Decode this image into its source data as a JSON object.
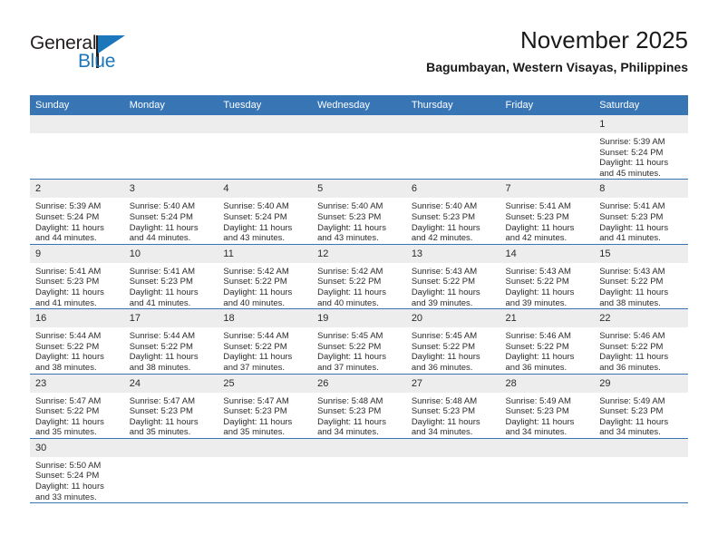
{
  "brand": {
    "name_part1": "General",
    "name_part2": "Blue",
    "accent_color": "#1b76bc"
  },
  "header": {
    "month_title": "November 2025",
    "location": "Bagumbayan, Western Visayas, Philippines"
  },
  "calendar": {
    "header_color": "#3775b5",
    "daynum_bg": "#ededed",
    "weekday_headers": [
      "Sunday",
      "Monday",
      "Tuesday",
      "Wednesday",
      "Thursday",
      "Friday",
      "Saturday"
    ],
    "weeks": [
      [
        {
          "blank": true,
          "day": "",
          "l1": "",
          "l2": "",
          "l3": "",
          "l4": ""
        },
        {
          "blank": true,
          "day": "",
          "l1": "",
          "l2": "",
          "l3": "",
          "l4": ""
        },
        {
          "blank": true,
          "day": "",
          "l1": "",
          "l2": "",
          "l3": "",
          "l4": ""
        },
        {
          "blank": true,
          "day": "",
          "l1": "",
          "l2": "",
          "l3": "",
          "l4": ""
        },
        {
          "blank": true,
          "day": "",
          "l1": "",
          "l2": "",
          "l3": "",
          "l4": ""
        },
        {
          "blank": true,
          "day": "",
          "l1": "",
          "l2": "",
          "l3": "",
          "l4": ""
        },
        {
          "blank": false,
          "day": "1",
          "l1": "Sunrise: 5:39 AM",
          "l2": "Sunset: 5:24 PM",
          "l3": "Daylight: 11 hours",
          "l4": "and 45 minutes."
        }
      ],
      [
        {
          "blank": false,
          "day": "2",
          "l1": "Sunrise: 5:39 AM",
          "l2": "Sunset: 5:24 PM",
          "l3": "Daylight: 11 hours",
          "l4": "and 44 minutes."
        },
        {
          "blank": false,
          "day": "3",
          "l1": "Sunrise: 5:40 AM",
          "l2": "Sunset: 5:24 PM",
          "l3": "Daylight: 11 hours",
          "l4": "and 44 minutes."
        },
        {
          "blank": false,
          "day": "4",
          "l1": "Sunrise: 5:40 AM",
          "l2": "Sunset: 5:24 PM",
          "l3": "Daylight: 11 hours",
          "l4": "and 43 minutes."
        },
        {
          "blank": false,
          "day": "5",
          "l1": "Sunrise: 5:40 AM",
          "l2": "Sunset: 5:23 PM",
          "l3": "Daylight: 11 hours",
          "l4": "and 43 minutes."
        },
        {
          "blank": false,
          "day": "6",
          "l1": "Sunrise: 5:40 AM",
          "l2": "Sunset: 5:23 PM",
          "l3": "Daylight: 11 hours",
          "l4": "and 42 minutes."
        },
        {
          "blank": false,
          "day": "7",
          "l1": "Sunrise: 5:41 AM",
          "l2": "Sunset: 5:23 PM",
          "l3": "Daylight: 11 hours",
          "l4": "and 42 minutes."
        },
        {
          "blank": false,
          "day": "8",
          "l1": "Sunrise: 5:41 AM",
          "l2": "Sunset: 5:23 PM",
          "l3": "Daylight: 11 hours",
          "l4": "and 41 minutes."
        }
      ],
      [
        {
          "blank": false,
          "day": "9",
          "l1": "Sunrise: 5:41 AM",
          "l2": "Sunset: 5:23 PM",
          "l3": "Daylight: 11 hours",
          "l4": "and 41 minutes."
        },
        {
          "blank": false,
          "day": "10",
          "l1": "Sunrise: 5:41 AM",
          "l2": "Sunset: 5:23 PM",
          "l3": "Daylight: 11 hours",
          "l4": "and 41 minutes."
        },
        {
          "blank": false,
          "day": "11",
          "l1": "Sunrise: 5:42 AM",
          "l2": "Sunset: 5:22 PM",
          "l3": "Daylight: 11 hours",
          "l4": "and 40 minutes."
        },
        {
          "blank": false,
          "day": "12",
          "l1": "Sunrise: 5:42 AM",
          "l2": "Sunset: 5:22 PM",
          "l3": "Daylight: 11 hours",
          "l4": "and 40 minutes."
        },
        {
          "blank": false,
          "day": "13",
          "l1": "Sunrise: 5:43 AM",
          "l2": "Sunset: 5:22 PM",
          "l3": "Daylight: 11 hours",
          "l4": "and 39 minutes."
        },
        {
          "blank": false,
          "day": "14",
          "l1": "Sunrise: 5:43 AM",
          "l2": "Sunset: 5:22 PM",
          "l3": "Daylight: 11 hours",
          "l4": "and 39 minutes."
        },
        {
          "blank": false,
          "day": "15",
          "l1": "Sunrise: 5:43 AM",
          "l2": "Sunset: 5:22 PM",
          "l3": "Daylight: 11 hours",
          "l4": "and 38 minutes."
        }
      ],
      [
        {
          "blank": false,
          "day": "16",
          "l1": "Sunrise: 5:44 AM",
          "l2": "Sunset: 5:22 PM",
          "l3": "Daylight: 11 hours",
          "l4": "and 38 minutes."
        },
        {
          "blank": false,
          "day": "17",
          "l1": "Sunrise: 5:44 AM",
          "l2": "Sunset: 5:22 PM",
          "l3": "Daylight: 11 hours",
          "l4": "and 38 minutes."
        },
        {
          "blank": false,
          "day": "18",
          "l1": "Sunrise: 5:44 AM",
          "l2": "Sunset: 5:22 PM",
          "l3": "Daylight: 11 hours",
          "l4": "and 37 minutes."
        },
        {
          "blank": false,
          "day": "19",
          "l1": "Sunrise: 5:45 AM",
          "l2": "Sunset: 5:22 PM",
          "l3": "Daylight: 11 hours",
          "l4": "and 37 minutes."
        },
        {
          "blank": false,
          "day": "20",
          "l1": "Sunrise: 5:45 AM",
          "l2": "Sunset: 5:22 PM",
          "l3": "Daylight: 11 hours",
          "l4": "and 36 minutes."
        },
        {
          "blank": false,
          "day": "21",
          "l1": "Sunrise: 5:46 AM",
          "l2": "Sunset: 5:22 PM",
          "l3": "Daylight: 11 hours",
          "l4": "and 36 minutes."
        },
        {
          "blank": false,
          "day": "22",
          "l1": "Sunrise: 5:46 AM",
          "l2": "Sunset: 5:22 PM",
          "l3": "Daylight: 11 hours",
          "l4": "and 36 minutes."
        }
      ],
      [
        {
          "blank": false,
          "day": "23",
          "l1": "Sunrise: 5:47 AM",
          "l2": "Sunset: 5:22 PM",
          "l3": "Daylight: 11 hours",
          "l4": "and 35 minutes."
        },
        {
          "blank": false,
          "day": "24",
          "l1": "Sunrise: 5:47 AM",
          "l2": "Sunset: 5:23 PM",
          "l3": "Daylight: 11 hours",
          "l4": "and 35 minutes."
        },
        {
          "blank": false,
          "day": "25",
          "l1": "Sunrise: 5:47 AM",
          "l2": "Sunset: 5:23 PM",
          "l3": "Daylight: 11 hours",
          "l4": "and 35 minutes."
        },
        {
          "blank": false,
          "day": "26",
          "l1": "Sunrise: 5:48 AM",
          "l2": "Sunset: 5:23 PM",
          "l3": "Daylight: 11 hours",
          "l4": "and 34 minutes."
        },
        {
          "blank": false,
          "day": "27",
          "l1": "Sunrise: 5:48 AM",
          "l2": "Sunset: 5:23 PM",
          "l3": "Daylight: 11 hours",
          "l4": "and 34 minutes."
        },
        {
          "blank": false,
          "day": "28",
          "l1": "Sunrise: 5:49 AM",
          "l2": "Sunset: 5:23 PM",
          "l3": "Daylight: 11 hours",
          "l4": "and 34 minutes."
        },
        {
          "blank": false,
          "day": "29",
          "l1": "Sunrise: 5:49 AM",
          "l2": "Sunset: 5:23 PM",
          "l3": "Daylight: 11 hours",
          "l4": "and 34 minutes."
        }
      ],
      [
        {
          "blank": false,
          "day": "30",
          "l1": "Sunrise: 5:50 AM",
          "l2": "Sunset: 5:24 PM",
          "l3": "Daylight: 11 hours",
          "l4": "and 33 minutes."
        },
        {
          "blank": true,
          "day": "",
          "l1": "",
          "l2": "",
          "l3": "",
          "l4": ""
        },
        {
          "blank": true,
          "day": "",
          "l1": "",
          "l2": "",
          "l3": "",
          "l4": ""
        },
        {
          "blank": true,
          "day": "",
          "l1": "",
          "l2": "",
          "l3": "",
          "l4": ""
        },
        {
          "blank": true,
          "day": "",
          "l1": "",
          "l2": "",
          "l3": "",
          "l4": ""
        },
        {
          "blank": true,
          "day": "",
          "l1": "",
          "l2": "",
          "l3": "",
          "l4": ""
        },
        {
          "blank": true,
          "day": "",
          "l1": "",
          "l2": "",
          "l3": "",
          "l4": ""
        }
      ]
    ]
  }
}
